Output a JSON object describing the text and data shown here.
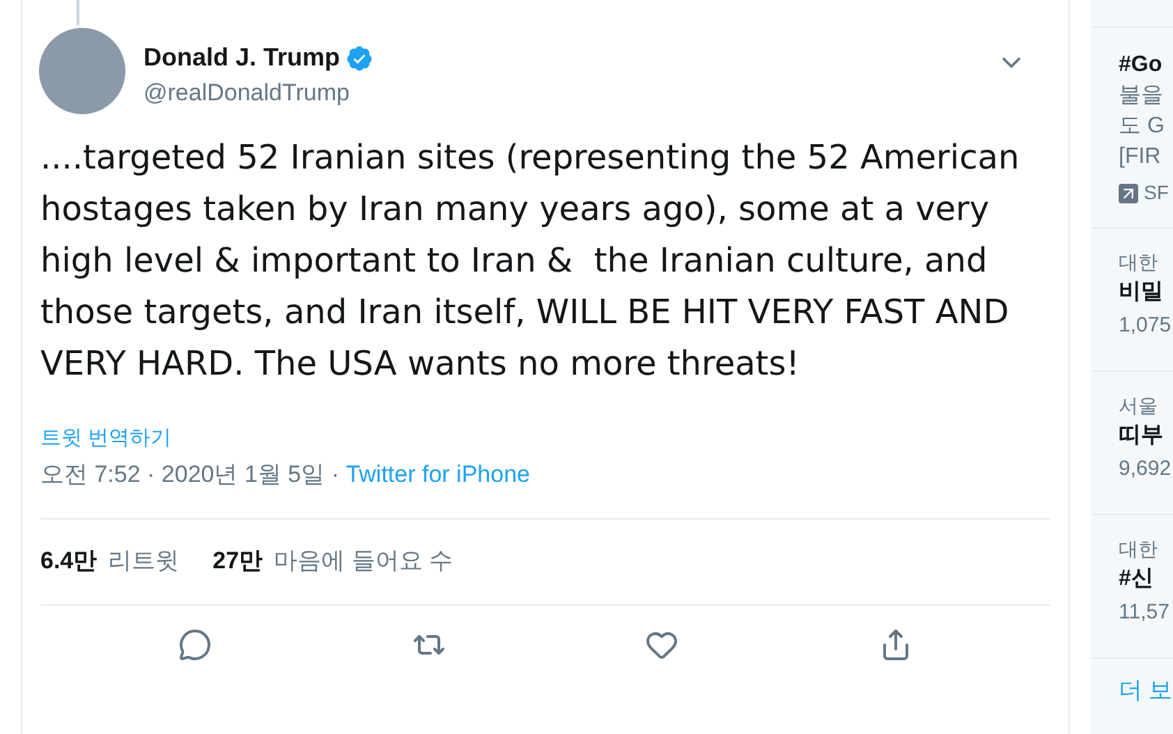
{
  "tweet": {
    "name": "Donald J. Trump",
    "verified": true,
    "handle": "@realDonaldTrump",
    "text": "....targeted 52 Iranian sites (representing the 52 American hostages taken by Iran many years ago), some at a very high level & important to Iran &  the Iranian culture, and those targets, and Iran itself, WILL BE HIT VERY FAST AND VERY HARD. The USA wants no more threats!",
    "translate": "트윗 번역하기",
    "time": "오전 7:52 · 2020년 1월 5일 · ",
    "source": "Twitter for iPhone",
    "stats": [
      {
        "count": "6.4만",
        "label": "리트윗"
      },
      {
        "count": "27만",
        "label": "마음에 들어요 수"
      }
    ]
  },
  "trends": [
    {
      "kind": "promoted",
      "title": "#Go",
      "lines": [
        "불을",
        "도 G",
        "[FIR"
      ],
      "promo": "SF"
    },
    {
      "kind": "trend",
      "context": "대한",
      "title": "비밀",
      "count": "1,075"
    },
    {
      "kind": "trend",
      "context": "서울",
      "title": "띠부",
      "count": "9,692"
    },
    {
      "kind": "trend",
      "context": "대한",
      "title": "#신",
      "count": "11,57"
    }
  ],
  "more": "더 보"
}
